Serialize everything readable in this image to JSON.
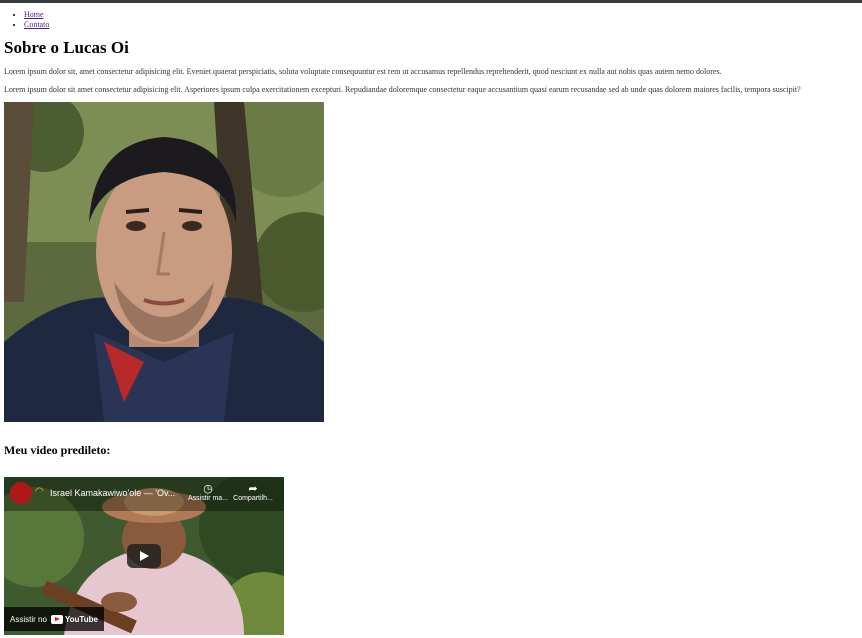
{
  "nav": {
    "items": [
      {
        "label": "Home"
      },
      {
        "label": "Contato"
      }
    ]
  },
  "page": {
    "title": "Sobre o Lucas Oi",
    "paragraphs": [
      "Lorem ipsum dolor sit, amet consectetur adipisicing elit. Eveniet quaerat perspiciatis, soluta voluptate consequuntur est rem ut accusamus repellendus reprehenderit, quod nesciunt ex nulla aut nobis quas autem nemo dolores.",
      "Lorem ipsum dolor sit amet consectetur adipisicing elit. Asperiores ipsum culpa exercitationem excepturi. Repudiandae doloremque consectetur eaque accusantium quasi earum recusandae sed ab unde quas dolorem maiores facilis, tempora suscipit?"
    ],
    "video_heading": "Meu video predileto:"
  },
  "video": {
    "title": "Israel Kamakawiwo'ole — 'Ov...",
    "watch_later": "Assistir ma...",
    "share": "Compartilh...",
    "watch_on": "Assistir no",
    "youtube": "YouTube"
  },
  "icons": [
    "clock-icon",
    "share-icon",
    "play-icon",
    "youtube-logo-icon",
    "channel-avatar-icon",
    "rainbow-icon"
  ]
}
